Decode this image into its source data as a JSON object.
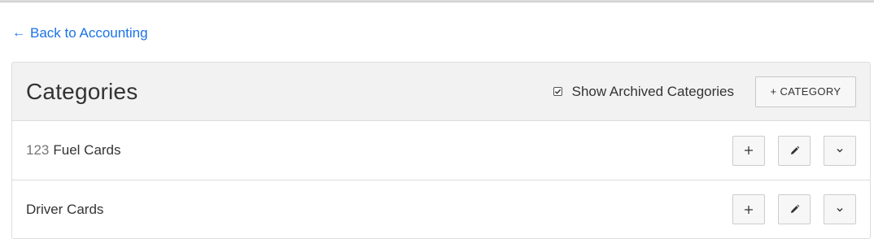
{
  "nav": {
    "back_icon": "arrow-left-icon",
    "back_label": "Back to Accounting"
  },
  "panel": {
    "title": "Categories",
    "show_archived": {
      "label": "Show Archived Categories",
      "checked": true
    },
    "add_button_label": "+ CATEGORY",
    "rows": [
      {
        "code": "123",
        "name": "Fuel Cards",
        "actions": [
          "plus-icon",
          "pencil-icon",
          "chevron-down-icon"
        ]
      },
      {
        "code": "",
        "name": "Driver Cards",
        "actions": [
          "plus-icon",
          "pencil-icon",
          "chevron-down-icon"
        ]
      }
    ]
  },
  "colors": {
    "link": "#1a73e8",
    "header_bg": "#f2f2f2",
    "border": "#dddddd",
    "muted_code": "#777777"
  }
}
